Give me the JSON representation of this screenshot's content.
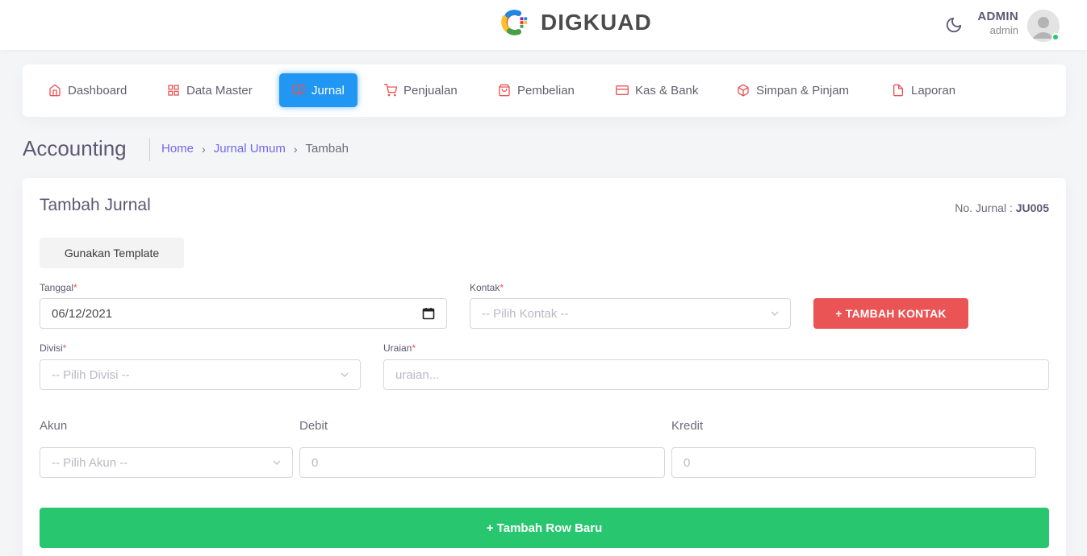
{
  "header": {
    "brand": "DIGKUAD",
    "user_name": "ADMIN",
    "user_role": "admin"
  },
  "nav": {
    "items": [
      {
        "label": "Dashboard",
        "icon": "home-icon"
      },
      {
        "label": "Data Master",
        "icon": "grid-icon"
      },
      {
        "label": "Jurnal",
        "icon": "book-open-icon",
        "active": true
      },
      {
        "label": "Penjualan",
        "icon": "cart-icon"
      },
      {
        "label": "Pembelian",
        "icon": "shopping-bag-icon"
      },
      {
        "label": "Kas & Bank",
        "icon": "credit-card-icon"
      },
      {
        "label": "Simpan & Pinjam",
        "icon": "box-icon"
      },
      {
        "label": "Laporan",
        "icon": "file-icon"
      }
    ]
  },
  "page": {
    "title": "Accounting",
    "breadcrumb": [
      "Home",
      "Jurnal Umum",
      "Tambah"
    ]
  },
  "form": {
    "title": "Tambah Jurnal",
    "jurnal_no_label": "No. Jurnal : ",
    "jurnal_no_value": "JU005",
    "template_button": "Gunakan Template",
    "tanggal_label": "Tanggal",
    "tanggal_value": "06/12/2021",
    "kontak_label": "Kontak",
    "kontak_placeholder": "-- Pilih Kontak --",
    "tambah_kontak_button": "+ TAMBAH KONTAK",
    "divisi_label": "Divisi",
    "divisi_placeholder": "-- Pilih Divisi --",
    "uraian_label": "Uraian",
    "uraian_placeholder": "uraian...",
    "columns": [
      "Akun",
      "Debit",
      "Kredit"
    ],
    "akun_placeholder": "-- Pilih Akun --",
    "debit_placeholder": "0",
    "kredit_placeholder": "0",
    "add_row_button": "+ Tambah Row Baru",
    "required_mark": "*"
  },
  "colors": {
    "primary": "#2196f3",
    "danger": "#ea5455",
    "success": "#28c76f",
    "link": "#7367f0",
    "nav_icon": "#ea5455"
  }
}
